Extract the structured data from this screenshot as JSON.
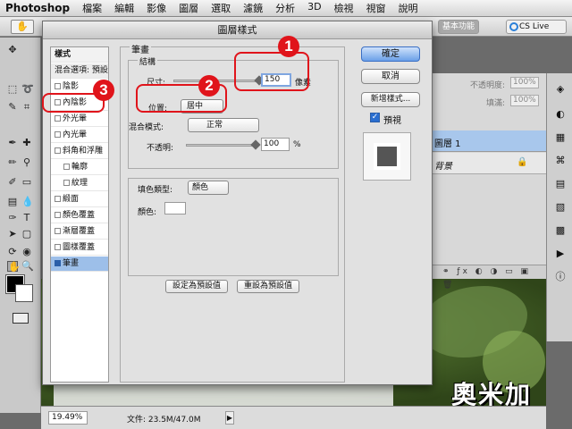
{
  "menubar": {
    "app_name": "Photoshop",
    "items": [
      "檔案",
      "編輯",
      "影像",
      "圖層",
      "選取",
      "濾鏡",
      "分析",
      "3D",
      "檢視",
      "視窗",
      "說明"
    ]
  },
  "options_bar": {
    "tool_icon": "hand-icon",
    "workspace_label": "基本功能",
    "cslive_label": "CS Live"
  },
  "dialog": {
    "title": "圖層樣式",
    "styles_list": {
      "header": "樣式",
      "items": [
        {
          "label": "混合選項: 預設",
          "checkbox": false,
          "checked": false,
          "selected": false
        },
        {
          "label": "陰影",
          "checkbox": true,
          "checked": false,
          "selected": false
        },
        {
          "label": "內陰影",
          "checkbox": true,
          "checked": false,
          "selected": false
        },
        {
          "label": "外光暈",
          "checkbox": true,
          "checked": false,
          "selected": false
        },
        {
          "label": "內光暈",
          "checkbox": true,
          "checked": false,
          "selected": false
        },
        {
          "label": "斜角和浮雕",
          "checkbox": true,
          "checked": false,
          "selected": false
        },
        {
          "label": "輪廓",
          "checkbox": true,
          "checked": false,
          "selected": false
        },
        {
          "label": "紋理",
          "checkbox": true,
          "checked": false,
          "selected": false
        },
        {
          "label": "緞面",
          "checkbox": true,
          "checked": false,
          "selected": false
        },
        {
          "label": "顏色覆蓋",
          "checkbox": true,
          "checked": false,
          "selected": false
        },
        {
          "label": "漸層覆蓋",
          "checkbox": true,
          "checked": false,
          "selected": false
        },
        {
          "label": "圖樣覆蓋",
          "checkbox": true,
          "checked": false,
          "selected": false
        },
        {
          "label": "筆畫",
          "checkbox": true,
          "checked": true,
          "selected": true
        }
      ]
    },
    "stroke": {
      "title": "筆畫",
      "structure_title": "結構",
      "size_label": "尺寸:",
      "size_value": "150",
      "size_unit": "像素",
      "size_fraction": 0.8,
      "position_label": "位置:",
      "position_value": "居中",
      "blend_label": "混合模式:",
      "blend_value": "正常",
      "opacity_label": "不透明:",
      "opacity_value": "100",
      "opacity_unit": "%",
      "opacity_fraction": 1.0,
      "fill_type_label": "填色類型:",
      "fill_type_value": "顏色",
      "color_label": "顏色:",
      "color_value": "#ffffff",
      "set_default_label": "設定為預設值",
      "reset_default_label": "重設為預設值"
    },
    "buttons": {
      "ok": "確定",
      "cancel": "取消",
      "new_style": "新增樣式...",
      "preview_label": "預視",
      "preview_checked": true
    }
  },
  "layers_panel": {
    "opacity_label": "不透明度:",
    "opacity_value": "100%",
    "fill_label": "填滿:",
    "fill_value": "100%",
    "layers": [
      {
        "name": "圖層 1",
        "selected": true,
        "locked": false
      },
      {
        "name": "背景",
        "selected": false,
        "locked": true
      }
    ]
  },
  "statusbar": {
    "zoom": "19.49%",
    "doc_size": "文件: 23.5M/47.0M"
  },
  "annotations": [
    {
      "number": "1"
    },
    {
      "number": "2"
    },
    {
      "number": "3"
    }
  ],
  "watermark": "奧米加",
  "colors": {
    "annotation_red": "#e0141b",
    "selection_blue": "#9dbfe9",
    "layer_selected_blue": "#a8c7ec"
  }
}
